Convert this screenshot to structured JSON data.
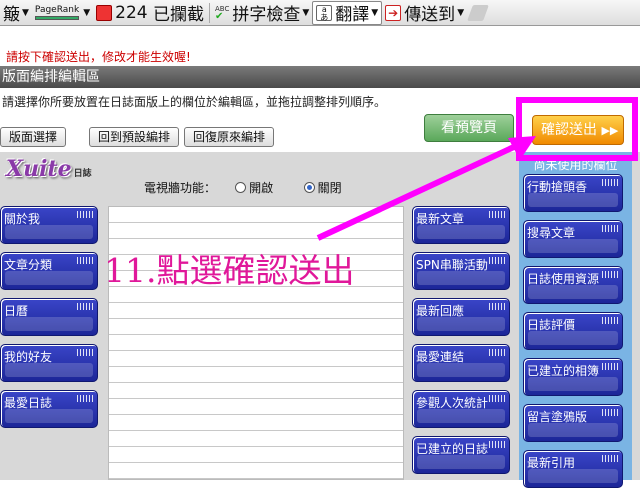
{
  "toolbar": {
    "items": {
      "first_label": "簸",
      "pagerank": "PageRank",
      "bookmarks_count": "224",
      "bookmarks": "已攔截",
      "spellcheck_abc": "ABC",
      "spellcheck": "拼字檢查",
      "translate": "翻譯",
      "sendto": "傳送到"
    }
  },
  "notice": "請按下確認送出，修改才能生效喔!",
  "title": "版面編排編輯區",
  "instruction": "請選擇你所要放置在日誌面版上的欄位於編輯區，並拖拉調整排列順序。",
  "buttons": {
    "layout_select": "版面選擇",
    "reset_default": "回到預設編排",
    "restore_original": "回復原來編排",
    "preview": "看預覽頁",
    "confirm": "確認送出"
  },
  "logo": {
    "text": "Xuite",
    "sub": "日誌"
  },
  "tv_wall": {
    "label": "電視牆功能：",
    "on": "開啟",
    "off": "關閉",
    "selected": "off"
  },
  "left_widgets": [
    "關於我",
    "文章分類",
    "日曆",
    "我的好友",
    "最愛日誌"
  ],
  "middle_widgets": [
    "最新文章",
    "SPN串聯活動",
    "最新回應",
    "最愛連結",
    "參觀人次統計",
    "已建立的日誌"
  ],
  "right_column": {
    "header": "尚未使用的欄位",
    "widgets": [
      "行動搶頭香",
      "搜尋文章",
      "日誌使用資源",
      "日誌評價",
      "已建立的相簿",
      "留言塗鴉版",
      "最新引用"
    ]
  },
  "annotation": "11.點選確認送出",
  "colors": {
    "highlight": "#ff00ff",
    "widget": "#2a36b8",
    "confirm": "#f29200",
    "notice": "#cc0000"
  }
}
